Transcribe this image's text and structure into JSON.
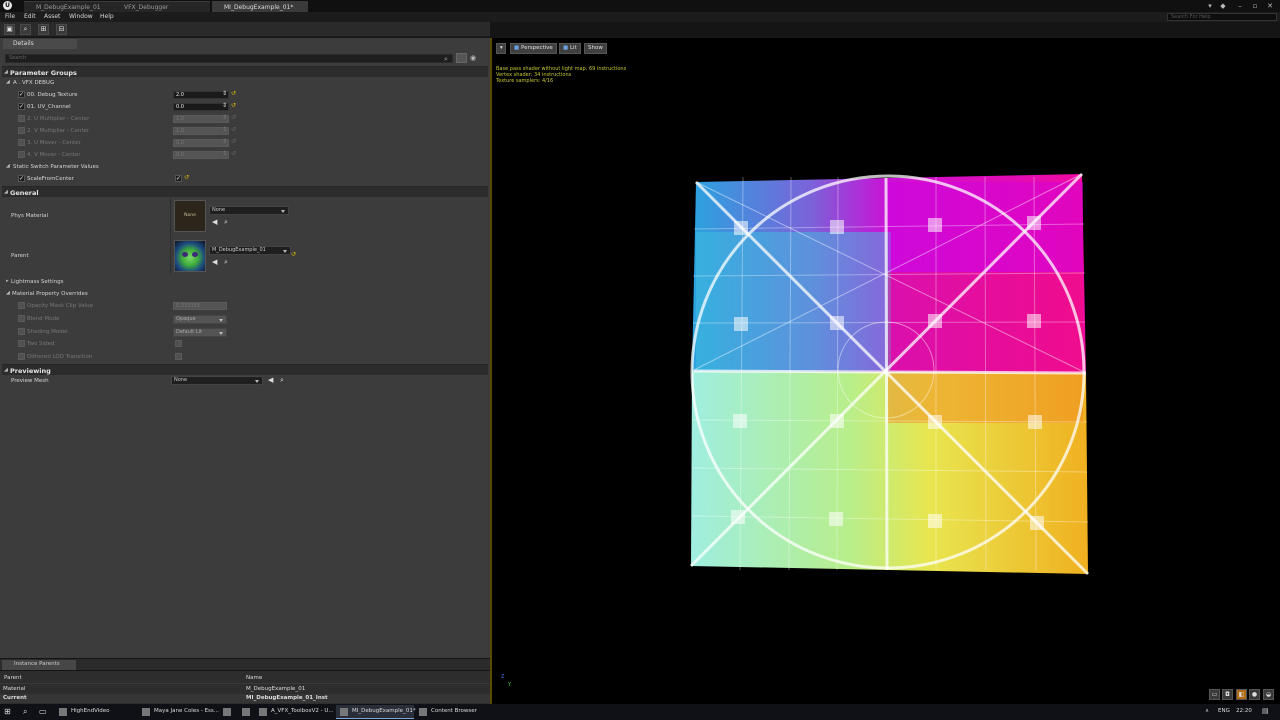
{
  "title_bar": {
    "logo": "U",
    "tabs": [
      "M_DebugExample_01",
      "VFX_Debugger",
      "MI_DebugExample_01*"
    ],
    "window_controls": [
      "minimize",
      "restore",
      "close"
    ]
  },
  "menu": {
    "items": [
      "File",
      "Edit",
      "Asset",
      "Window",
      "Help"
    ],
    "search_placeholder": "Search For Help"
  },
  "toolbar": {
    "buttons": [
      "save-icon",
      "browse-icon",
      "params-icon",
      "hierarchy-icon"
    ]
  },
  "details": {
    "tab_label": "Details",
    "search_placeholder": "Search",
    "parameter_groups_label": "Parameter Groups",
    "vfx_debug_label": "A . VFX DEBUG",
    "params": [
      {
        "label": "00. Debug Texture",
        "value": "2.0",
        "checked": true,
        "enabled": true
      },
      {
        "label": "01. UV_Channel",
        "value": "0.0",
        "checked": true,
        "enabled": true
      },
      {
        "label": "2. U Multiplier - Center",
        "value": "1.0",
        "checked": false,
        "enabled": false
      },
      {
        "label": "2. V Multiplier - Center",
        "value": "1.0",
        "checked": false,
        "enabled": false
      },
      {
        "label": "3. U Mover - Center",
        "value": "0.0",
        "checked": false,
        "enabled": false
      },
      {
        "label": "4. V Mover - Center",
        "value": "0.0",
        "checked": false,
        "enabled": false
      }
    ],
    "static_switch_label": "Static Switch Parameter Values",
    "scale_from_center_label": "ScaleFromCenter",
    "general_label": "General",
    "phys_material_label": "Phys Material",
    "phys_thumb_text": "None",
    "phys_material_value": "None",
    "parent_label": "Parent",
    "parent_value": "M_DebugExample_01",
    "lightmass_label": "Lightmass Settings",
    "overrides_label": "Material Property Overrides",
    "overrides": [
      {
        "label": "Opacity Mask Clip Value",
        "value": "0.333333",
        "kind": "number"
      },
      {
        "label": "Blend Mode",
        "value": "Opaque",
        "kind": "combo"
      },
      {
        "label": "Shading Model",
        "value": "Default Lit",
        "kind": "combo"
      },
      {
        "label": "Two Sided",
        "value": "",
        "kind": "check"
      },
      {
        "label": "Dithered LOD Transition",
        "value": "",
        "kind": "check"
      }
    ],
    "previewing_label": "Previewing",
    "preview_mesh_label": "Preview Mesh",
    "preview_mesh_value": "None"
  },
  "instance_parents": {
    "tab_label": "Instance Parents",
    "columns": [
      "Parent",
      "Name"
    ],
    "rows": [
      {
        "parent": "Material",
        "name": "M_DebugExample_01"
      },
      {
        "parent": "Current",
        "name": "MI_DebugExample_01_Inst"
      }
    ]
  },
  "viewport": {
    "buttons": [
      "Perspective",
      "Lit",
      "Show"
    ],
    "stats": [
      "Base pass shader without light map: 69 instructions",
      "Vertex shader: 34 instructions",
      "Texture samplers: 4/16"
    ],
    "axis_labels": [
      "Z",
      "Y"
    ],
    "bottom_icons": [
      "plane-icon",
      "cylinder-icon",
      "cube-icon",
      "sphere-icon",
      "teapot-icon",
      "custom-mesh-icon"
    ]
  },
  "taskbar": {
    "items": [
      "HighEndVideo",
      "Maya Jane Coles - Ess...",
      "",
      "A_VFX_ToolboxV2 - U...",
      "MI_DebugExample_01*",
      "Content Browser"
    ],
    "language": "ENG",
    "time": "22:20"
  }
}
